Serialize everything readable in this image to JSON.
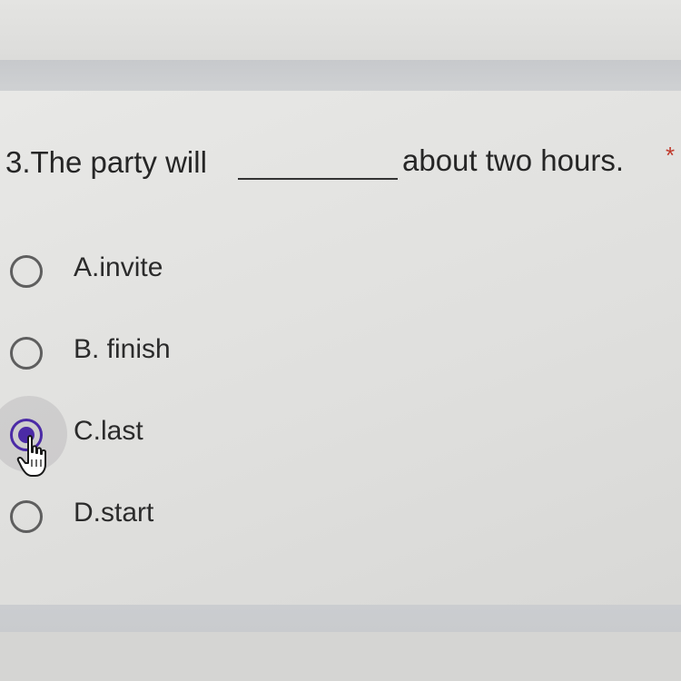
{
  "question": {
    "number_and_start": "3.The party will",
    "end": "about two hours.",
    "required_marker": "*"
  },
  "options": [
    {
      "label": "A.invite",
      "selected": false
    },
    {
      "label": "B. finish",
      "selected": false
    },
    {
      "label": "C.last",
      "selected": true
    },
    {
      "label": "D.start",
      "selected": false
    }
  ],
  "colors": {
    "accent": "#4b2aa6",
    "required": "#c0392b"
  },
  "icons": {
    "cursor": "hand-pointer-icon"
  }
}
